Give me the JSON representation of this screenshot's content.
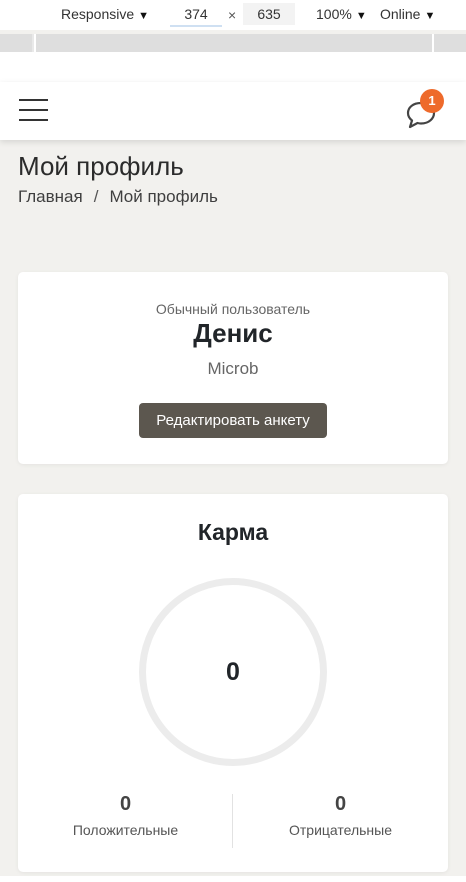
{
  "devtools": {
    "device": "Responsive",
    "width": "374",
    "height": "635",
    "zoom": "100%",
    "network": "Online",
    "times": "×"
  },
  "header": {
    "menu_icon": "hamburger-menu-icon",
    "chat_icon": "chat-bubble-icon",
    "notifications_count": "1",
    "badge_color": "#ee6a2b"
  },
  "page": {
    "title": "Мой профиль",
    "breadcrumb": {
      "home": "Главная",
      "separator": "/",
      "current": "Мой профиль"
    }
  },
  "profile": {
    "role": "Обычный пользователь",
    "name": "Денис",
    "login": "Microb",
    "edit_button": "Редактировать анкету",
    "button_color": "#5c574f"
  },
  "karma": {
    "title": "Карма",
    "value": "0",
    "positive_value": "0",
    "positive_label": "Положительные",
    "negative_value": "0",
    "negative_label": "Отрицательные"
  }
}
